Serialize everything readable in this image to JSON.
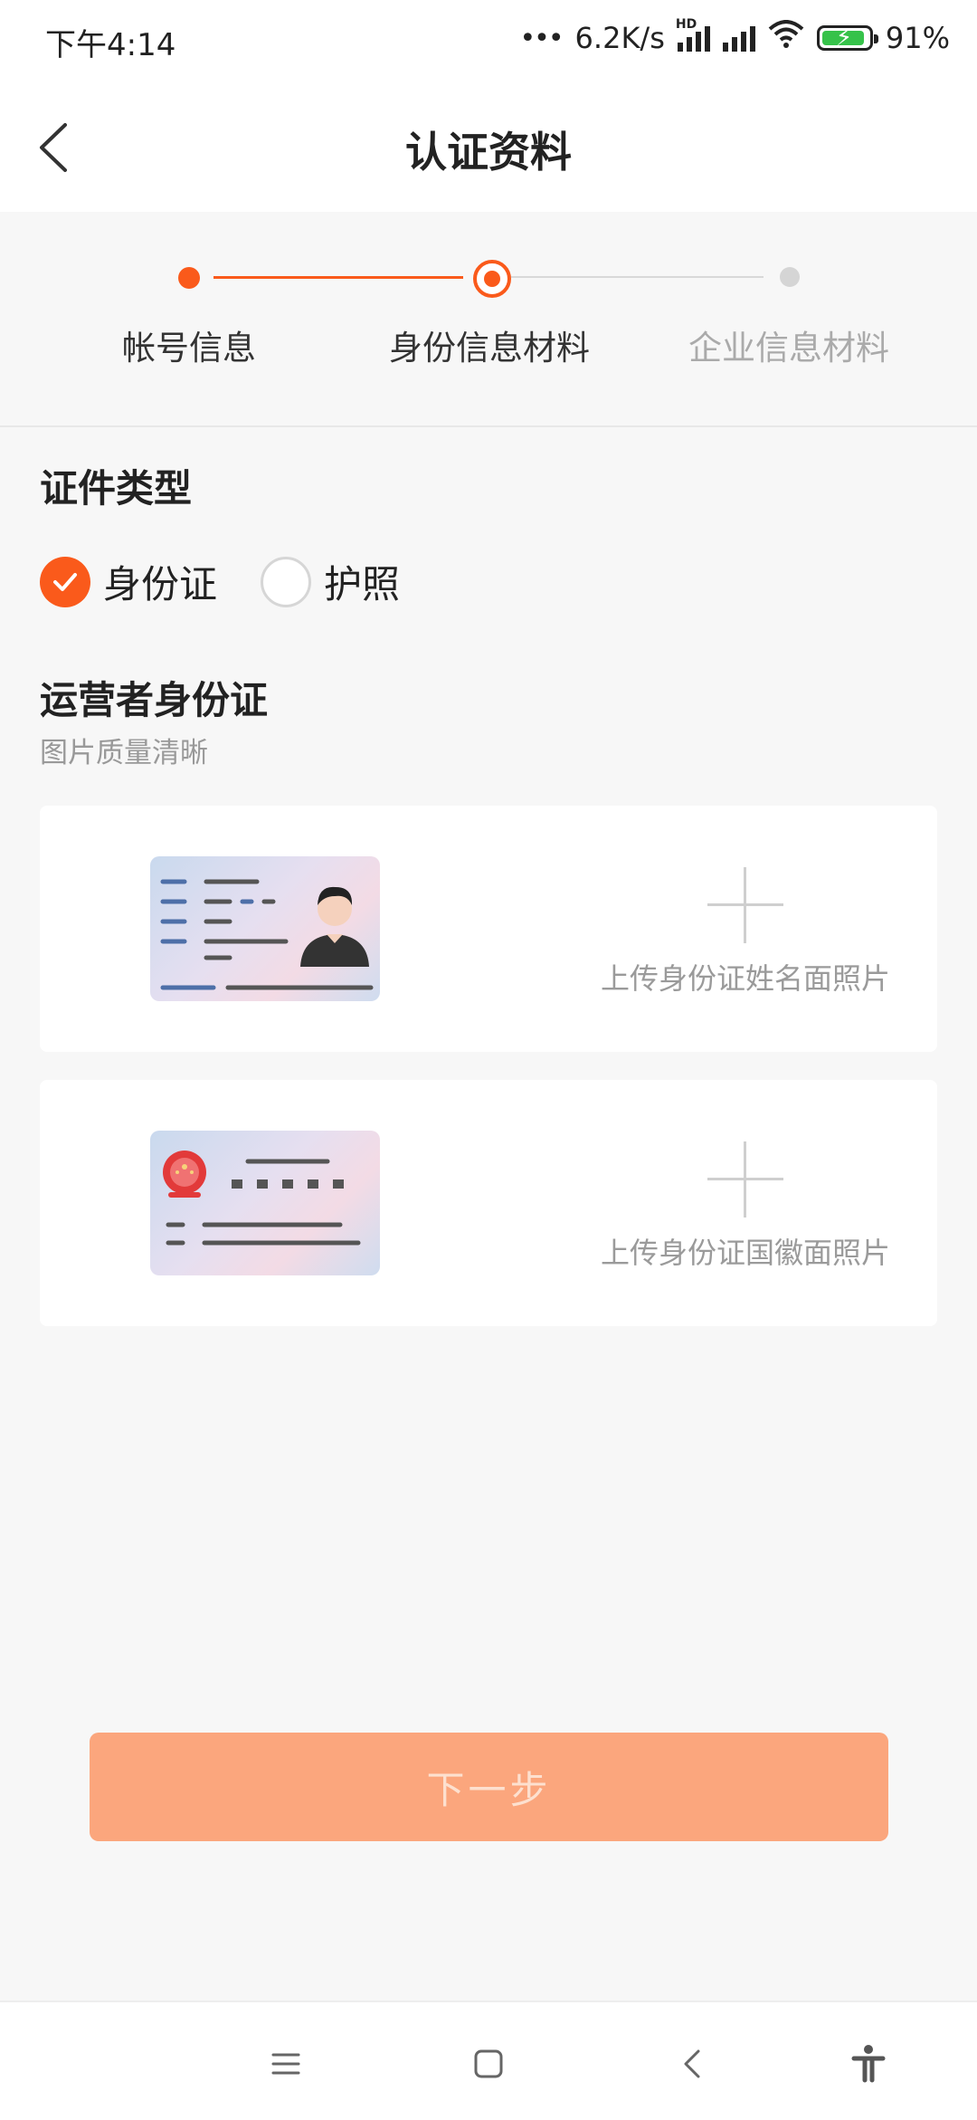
{
  "status_bar": {
    "time": "下午4:14",
    "network_speed": "6.2K/s",
    "network_type": "HD",
    "battery": "91%",
    "battery_level": 0.91
  },
  "header": {
    "title": "认证资料",
    "back_icon": "chevron-left-icon"
  },
  "steps": {
    "current_index": 1,
    "items": [
      {
        "label": "帐号信息",
        "state": "done"
      },
      {
        "label": "身份信息材料",
        "state": "current"
      },
      {
        "label": "企业信息材料",
        "state": "pending"
      }
    ]
  },
  "doc_type": {
    "title": "证件类型",
    "options": [
      {
        "label": "身份证",
        "selected": true
      },
      {
        "label": "护照",
        "selected": false
      }
    ]
  },
  "operator_id": {
    "title": "运营者身份证",
    "hint": "图片质量清晰",
    "front_upload_label": "上传身份证姓名面照片",
    "back_upload_label": "上传身份证国徽面照片"
  },
  "next_button": {
    "label": "下一步",
    "enabled": false
  },
  "nav_bar": {
    "icons": [
      "menu-icon",
      "home-square-icon",
      "back-icon",
      "accessibility-icon"
    ]
  },
  "colors": {
    "accent": "#fa5a1b",
    "button_disabled": "#fba67d",
    "background": "#f7f7f7",
    "pending": "#cccccc"
  }
}
